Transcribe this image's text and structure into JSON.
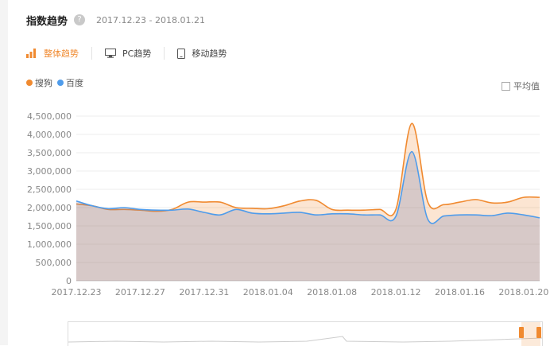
{
  "header": {
    "title": "指数趋势",
    "help_icon": "question-circle-icon",
    "help_glyph": "?",
    "date_range": "2017.12.23 - 2018.01.21"
  },
  "tabs": [
    {
      "label": "整体趋势",
      "icon": "bar-chart-icon",
      "active": true
    },
    {
      "label": "PC趋势",
      "icon": "monitor-icon",
      "active": false
    },
    {
      "label": "移动趋势",
      "icon": "phone-icon",
      "active": false
    }
  ],
  "legend": [
    {
      "label": "搜狗",
      "color": "#f08a30"
    },
    {
      "label": "百度",
      "color": "#4f9ceb"
    }
  ],
  "average_toggle": {
    "label": "平均值",
    "checked": false
  },
  "colors": {
    "accent": "#f08a30",
    "sogou": "#f08a30",
    "baidu": "#4f9ceb"
  },
  "chart_data": {
    "type": "area",
    "y_ticks": [
      "0",
      "500,000",
      "1,000,000",
      "1,500,000",
      "2,000,000",
      "2,500,000",
      "3,000,000",
      "3,500,000",
      "4,000,000",
      "4,500,000"
    ],
    "x_ticks": [
      "2017.12.23",
      "2017.12.27",
      "2017.12.31",
      "2018.01.04",
      "2018.01.08",
      "2018.01.12",
      "2018.01.16",
      "2018.01.20"
    ],
    "x_tick_index": [
      0,
      4,
      8,
      12,
      16,
      20,
      24,
      28
    ],
    "ylim": [
      0,
      4500000
    ],
    "grid": true,
    "series": [
      {
        "name": "搜狗",
        "color": "#f08a30",
        "values": [
          2100000,
          2050000,
          1950000,
          1950000,
          1930000,
          1900000,
          1950000,
          2150000,
          2150000,
          2150000,
          2000000,
          1980000,
          1970000,
          2050000,
          2180000,
          2200000,
          1950000,
          1930000,
          1930000,
          1950000,
          1950000,
          4300000,
          2150000,
          2080000,
          2150000,
          2220000,
          2130000,
          2150000,
          2280000,
          2280000
        ]
      },
      {
        "name": "百度",
        "color": "#4f9ceb",
        "values": [
          2180000,
          2050000,
          1970000,
          2000000,
          1950000,
          1930000,
          1930000,
          1960000,
          1870000,
          1800000,
          1950000,
          1850000,
          1830000,
          1850000,
          1870000,
          1800000,
          1830000,
          1830000,
          1800000,
          1800000,
          1760000,
          3530000,
          1680000,
          1770000,
          1800000,
          1800000,
          1780000,
          1850000,
          1800000,
          1720000
        ]
      }
    ]
  }
}
